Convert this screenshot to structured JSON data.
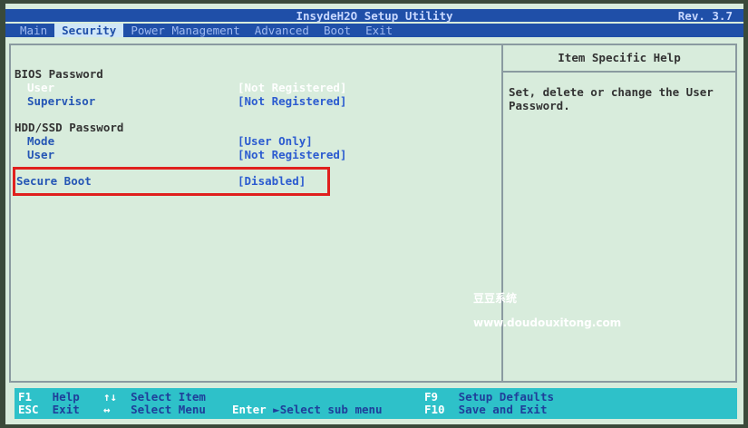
{
  "title": "InsydeH2O Setup Utility",
  "revision": "Rev. 3.7",
  "menu": [
    "Main",
    "Security",
    "Power Management",
    "Advanced",
    "Boot",
    "Exit"
  ],
  "active_menu": "Security",
  "bios_password": {
    "heading": "BIOS Password",
    "user_label": "User",
    "user_value": "[Not Registered]",
    "supervisor_label": "Supervisor",
    "supervisor_value": "[Not Registered]"
  },
  "hdd_password": {
    "heading": "HDD/SSD Password",
    "mode_label": "Mode",
    "mode_value": "[User Only]",
    "user_label": "User",
    "user_value": "[Not Registered]"
  },
  "secure_boot": {
    "label": "Secure Boot",
    "value": "[Disabled]"
  },
  "help": {
    "title": "Item Specific Help",
    "text": "Set, delete or change the User Password."
  },
  "watermark": {
    "line1": "豆豆系统",
    "line2": "www.doudouxitong.com"
  },
  "footer": {
    "f1_key": "F1",
    "f1_desc": "Help",
    "esc_key": "ESC",
    "esc_desc": "Exit",
    "updown_key": "↑↓",
    "updown_desc": "Select Item",
    "lr_key": "↔",
    "lr_desc": "Select Menu",
    "enter_key": "Enter",
    "enter_desc": "►Select sub menu",
    "f9_key": "F9",
    "f9_desc": "Setup Defaults",
    "f10_key": "F10",
    "f10_desc": "Save and Exit"
  },
  "colors": {
    "bar_blue": "#1f4fa8",
    "screen_bg": "#d8ecdc",
    "footer_cyan": "#2ec1c9",
    "highlight_red": "#e0201e"
  }
}
